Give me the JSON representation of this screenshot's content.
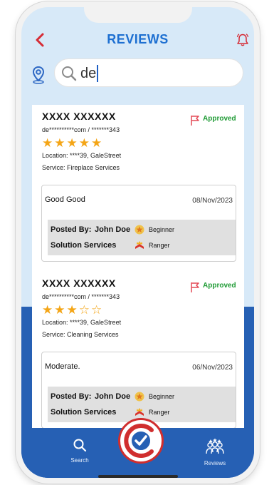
{
  "header": {
    "title": "REVIEWS"
  },
  "search": {
    "value": "de"
  },
  "reviews": [
    {
      "name": "XXXX  XXXXXX",
      "contact": "de**********com / *******343",
      "rating": 5,
      "stars_filled": "★★★★★",
      "stars_empty": "",
      "location": "Location: ****39, GaleStreet",
      "service": "Service: Fireplace Services",
      "status": "Approved",
      "comment": "Good Good",
      "date": "08/Nov/2023",
      "posted_by_label": "Posted By:",
      "posted_by": "John Doe",
      "posted_badge": "Beginner",
      "provider": "Solution Services",
      "provider_badge": "Ranger"
    },
    {
      "name": "XXXX  XXXXXX",
      "contact": "de**********com / *******343",
      "rating": 3,
      "stars_filled": "★★★",
      "stars_empty": "☆☆",
      "location": "Location: ****39, GaleStreet",
      "service": "Service: Cleaning Services",
      "status": "Approved",
      "comment": "Moderate.",
      "date": "06/Nov/2023",
      "posted_by_label": "Posted By:",
      "posted_by": "John Doe",
      "posted_badge": "Beginner",
      "provider": "Solution Services",
      "provider_badge": "Ranger"
    }
  ],
  "nav": {
    "search_label": "Search",
    "reviews_label": "Reviews"
  },
  "colors": {
    "accent": "#1d6fd1",
    "nav_blue": "#2660b4",
    "approved": "#1f9b35",
    "star": "#f4a516",
    "back": "#d62b35"
  },
  "icons": [
    "back-arrow-icon",
    "bell-icon",
    "location-pin-icon",
    "search-icon",
    "flag-icon",
    "star-badge-icon",
    "ranger-badge-icon",
    "checkmark-logo-icon",
    "reviews-group-icon"
  ]
}
